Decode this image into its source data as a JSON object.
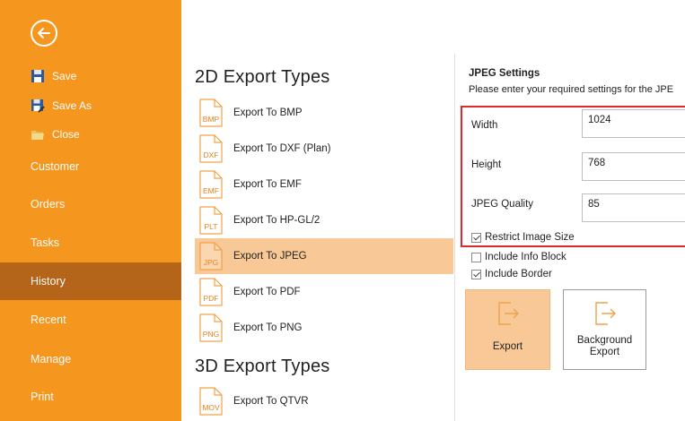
{
  "sidebar": {
    "commands": [
      {
        "label": "Save",
        "icon": "save-icon"
      },
      {
        "label": "Save As",
        "icon": "save-as-icon"
      },
      {
        "label": "Close",
        "icon": "close-folder-icon"
      }
    ],
    "items": [
      {
        "label": "Customer",
        "active": false
      },
      {
        "label": "Orders",
        "active": false
      },
      {
        "label": "Tasks",
        "active": false
      },
      {
        "label": "History",
        "active": true
      },
      {
        "label": "Recent",
        "active": false
      },
      {
        "label": "Manage",
        "active": false
      },
      {
        "label": "Print",
        "active": false
      }
    ],
    "colors": {
      "background": "#f5961e",
      "active": "#b5651a"
    }
  },
  "export_types": {
    "heading_2d": "2D Export Types",
    "items_2d": [
      {
        "ext": "BMP",
        "label": "Export To BMP"
      },
      {
        "ext": "DXF",
        "label": "Export To DXF (Plan)"
      },
      {
        "ext": "EMF",
        "label": "Export To EMF"
      },
      {
        "ext": "PLT",
        "label": "Export To HP-GL/2"
      },
      {
        "ext": "JPG",
        "label": "Export To JPEG",
        "selected": true
      },
      {
        "ext": "PDF",
        "label": "Export To PDF"
      },
      {
        "ext": "PNG",
        "label": "Export To PNG"
      }
    ],
    "heading_3d": "3D Export Types",
    "items_3d": [
      {
        "ext": "MOV",
        "label": "Export To QTVR"
      }
    ]
  },
  "settings": {
    "title": "JPEG Settings",
    "description": "Please enter your required settings for the JPE",
    "fields": [
      {
        "label": "Width",
        "value": "1024"
      },
      {
        "label": "Height",
        "value": "768"
      },
      {
        "label": "JPEG Quality",
        "value": "85"
      }
    ],
    "checkboxes": [
      {
        "label": "Restrict Image Size",
        "checked": true
      },
      {
        "label": "Include Info Block",
        "checked": false
      },
      {
        "label": "Include Border",
        "checked": true
      }
    ],
    "buttons": {
      "export": "Export",
      "background_export_line1": "Background",
      "background_export_line2": "Export"
    },
    "highlight_color": "#e0262f",
    "selected_color": "#f8c996"
  }
}
